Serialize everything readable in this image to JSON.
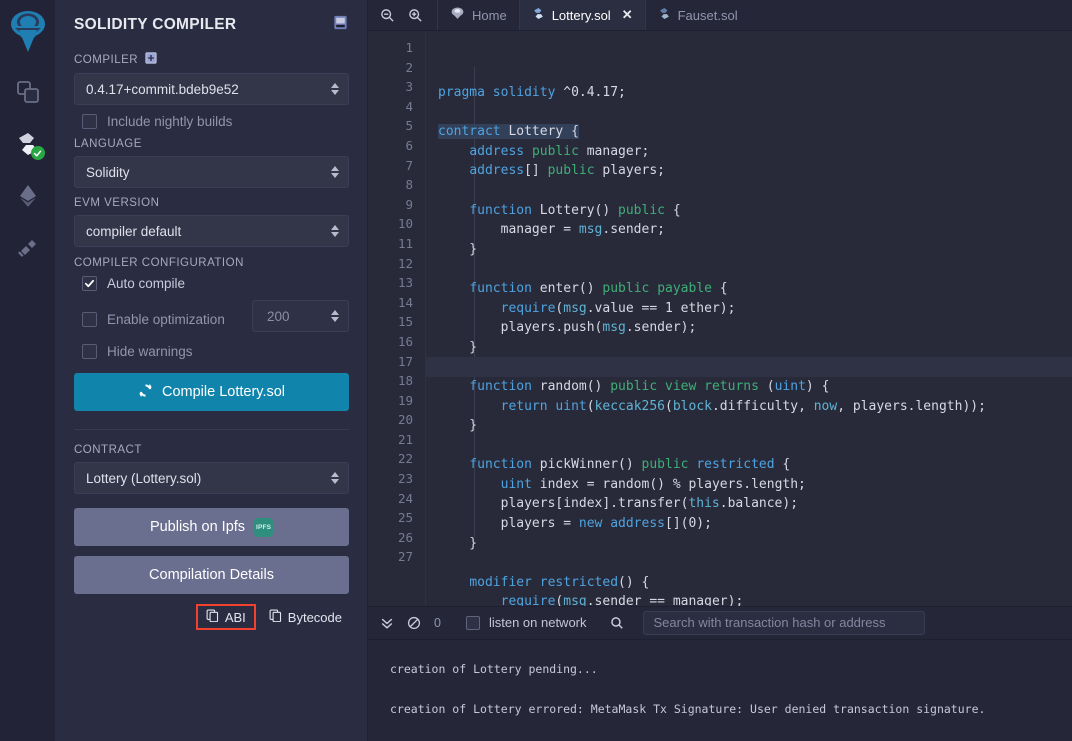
{
  "rail": {
    "logo_icon": "remix-logo-icon",
    "items": [
      {
        "name": "file-explorers",
        "icon": "files-icon"
      },
      {
        "name": "solidity-compiler",
        "icon": "solidity-icon",
        "status": "compiled-ok"
      },
      {
        "name": "deploy-run-transactions",
        "icon": "ethereum-icon"
      },
      {
        "name": "plugin-manager",
        "icon": "plug-icon"
      }
    ]
  },
  "panel": {
    "title": "SOLIDITY COMPILER",
    "doc_icon": "book-icon",
    "compiler_label": "COMPILER",
    "compiler_add_icon": "add-square-icon",
    "compiler_version": "0.4.17+commit.bdeb9e52",
    "nightly_label": "Include nightly builds",
    "nightly_checked": false,
    "language_label": "LANGUAGE",
    "language_value": "Solidity",
    "evm_label": "EVM VERSION",
    "evm_value": "compiler default",
    "config_label": "COMPILER CONFIGURATION",
    "auto_compile_label": "Auto compile",
    "auto_compile_checked": true,
    "optimize_label": "Enable optimization",
    "optimize_checked": false,
    "runs_value": "200",
    "hide_warnings_label": "Hide warnings",
    "hide_warnings_checked": false,
    "compile_button": "Compile Lottery.sol",
    "compile_icon": "refresh-icon",
    "contract_label": "CONTRACT",
    "contract_value": "Lottery (Lottery.sol)",
    "publish_button": "Publish on Ipfs",
    "ipfs_badge": "IPFS",
    "details_button": "Compilation Details",
    "abi_label": "ABI",
    "bytecode_label": "Bytecode",
    "copy_icon": "copy-icon",
    "abi_highlight_color": "#f4402e"
  },
  "tabbar": {
    "zoom_out_icon": "zoom-out-icon",
    "zoom_in_icon": "zoom-in-icon",
    "tabs": [
      {
        "label": "Home",
        "icon": "remix-logo-icon",
        "active": false,
        "closable": false
      },
      {
        "label": "Lottery.sol",
        "icon": "solidity-icon",
        "active": true,
        "closable": true
      },
      {
        "label": "Fauset.sol",
        "icon": "solidity-icon",
        "active": false,
        "closable": false
      }
    ],
    "close_icon": "close-icon"
  },
  "editor": {
    "line_numbers": [
      1,
      2,
      3,
      4,
      5,
      6,
      7,
      8,
      9,
      10,
      11,
      12,
      13,
      14,
      15,
      16,
      17,
      18,
      19,
      20,
      21,
      22,
      23,
      24,
      25,
      26,
      27
    ],
    "highlight_line": 15,
    "lines": [
      "pragma solidity ^0.4.17;",
      "",
      "contract Lottery {",
      "    address public manager;",
      "    address[] public players;",
      "",
      "    function Lottery() public {",
      "        manager = msg.sender;",
      "    }",
      "",
      "    function enter() public payable {",
      "        require(msg.value == 1 ether);",
      "        players.push(msg.sender);",
      "    }",
      "",
      "    function random() public view returns (uint) {",
      "        return uint(keccak256(block.difficulty, now, players.length));",
      "    }",
      "",
      "    function pickWinner() public restricted {",
      "        uint index = random() % players.length;",
      "        players[index].transfer(this.balance);",
      "        players = new address[](0);",
      "    }",
      "",
      "    modifier restricted() {",
      "        require(msg.sender == manager);"
    ]
  },
  "terminal": {
    "collapse_icon": "chevron-double-down-icon",
    "clear_icon": "ban-icon",
    "count": "0",
    "listen_label": "listen on network",
    "listen_checked": false,
    "search_icon": "search-icon",
    "search_placeholder": "Search with transaction hash or address",
    "search_value": "",
    "output": [
      "creation of Lottery pending...",
      "creation of Lottery errored: MetaMask Tx Signature: User denied transaction signature."
    ]
  }
}
